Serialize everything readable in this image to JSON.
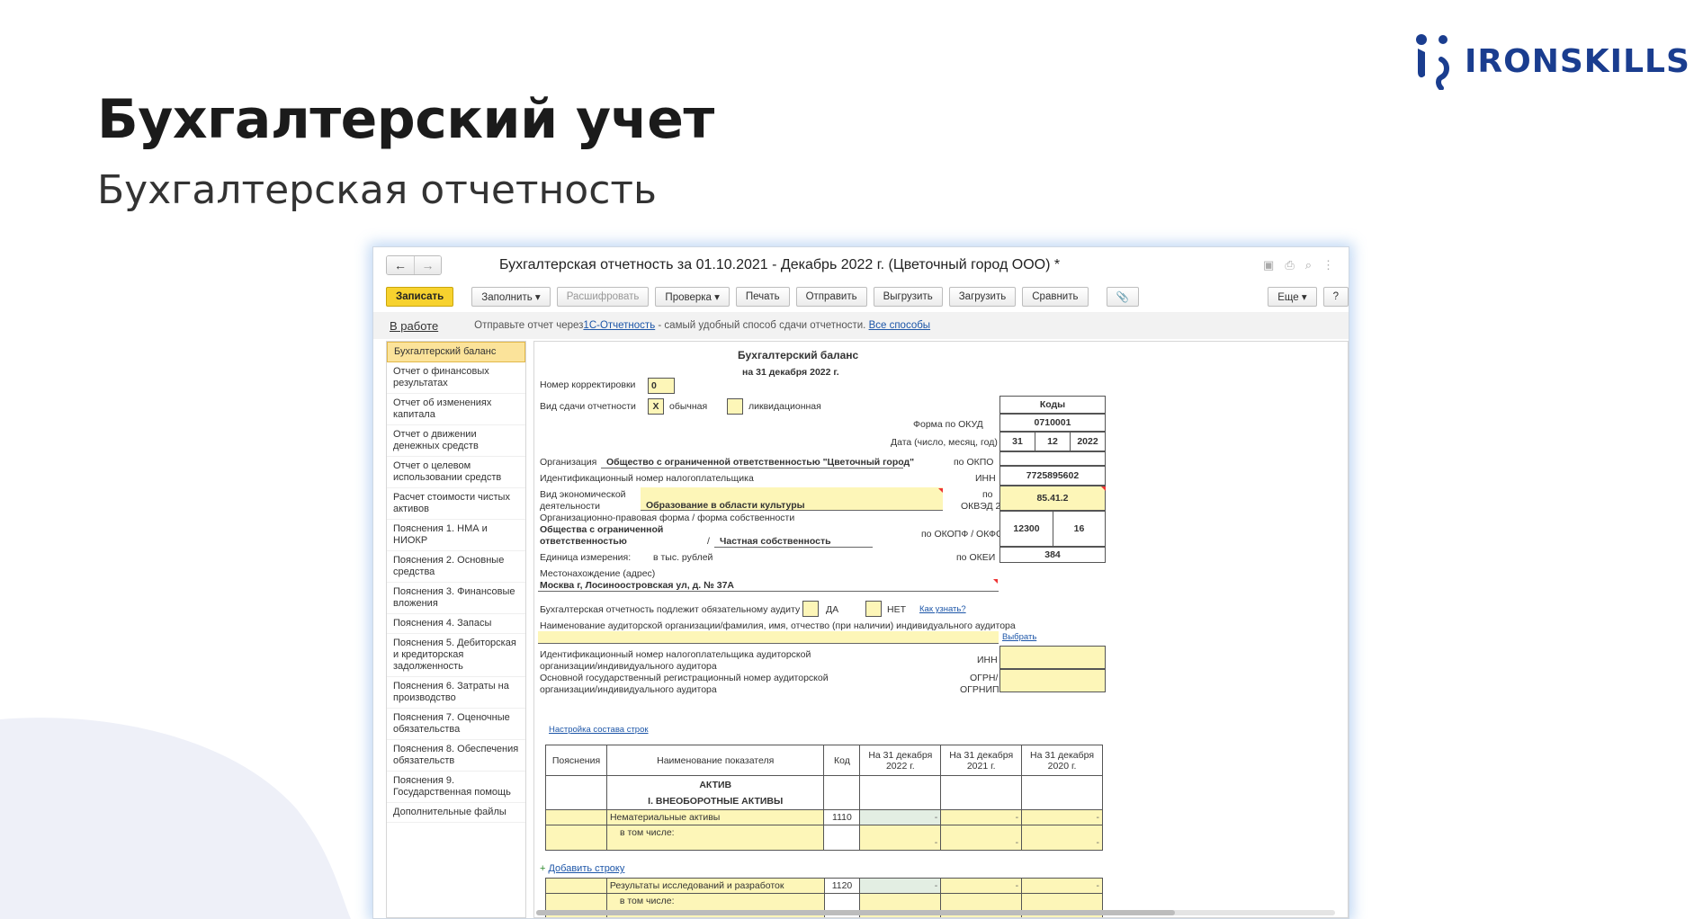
{
  "slide": {
    "title": "Бухгалтерский учет",
    "subtitle": "Бухгалтерская отчетность",
    "logo_text": "IRONSKILLS",
    "colors": {
      "logo": "#1a3d8f",
      "wave": "#eef0f8"
    }
  },
  "window": {
    "title": "Бухгалтерская отчетность за 01.10.2021 - Декабрь 2022 г. (Цветочный город ООО) *",
    "back_icon": "←",
    "forward_icon": "→",
    "more_icon": "⋮"
  },
  "toolbar": {
    "save": "Записать",
    "fill": "Заполнить ▾",
    "decode": "Расшифровать",
    "check": "Проверка ▾",
    "print": "Печать",
    "send": "Отправить",
    "export": "Выгрузить",
    "import": "Загрузить",
    "compare": "Сравнить",
    "attach_icon": "📎",
    "more": "Еще ▾",
    "help": "?"
  },
  "infobar": {
    "status": "В работе",
    "text_before": "Отправьте отчет через ",
    "link1": "1С-Отчетность",
    "text_after": " - самый удобный способ сдачи отчетности. ",
    "link2": "Все способы"
  },
  "sidebar": {
    "items": [
      "Бухгалтерский баланс",
      "Отчет о финансовых результатах",
      "Отчет об изменениях капитала",
      "Отчет о движении денежных средств",
      "Отчет о целевом использовании средств",
      "Расчет стоимости чистых активов",
      "Пояснения 1. НМА и НИОКР",
      "Пояснения 2. Основные средства",
      "Пояснения 3. Финансовые вложения",
      "Пояснения 4. Запасы",
      "Пояснения 5. Дебиторская и кредиторская задолженность",
      "Пояснения 6. Затраты на производство",
      "Пояснения 7. Оценочные обязательства",
      "Пояснения 8. Обеспечения обязательств",
      "Пояснения 9. Государственная помощь",
      "Дополнительные файлы"
    ]
  },
  "form": {
    "heading": "Бухгалтерский баланс",
    "date_heading": "на 31 декабря 2022 г.",
    "correction_label": "Номер корректировки",
    "correction_value": "0",
    "type_label": "Вид сдачи отчетности",
    "type_check": "X",
    "type_ordinary": "обычная",
    "type_liquidation": "ликвидационная",
    "codes_header": "Коды",
    "okud_label": "Форма по ОКУД",
    "okud_value": "0710001",
    "date_label": "Дата (число, месяц, год)",
    "date_day": "31",
    "date_month": "12",
    "date_year": "2022",
    "org_label": "Организация",
    "org_value": "Общество с ограниченной ответственностью \"Цветочный город\"",
    "okpo_label": "по ОКПО",
    "inn_caption": "Идентификационный номер налогоплательщика",
    "inn_label": "ИНН",
    "inn_value": "7725895602",
    "activity_label1": "Вид экономической",
    "activity_label2": "деятельности",
    "activity_value": "Образование в области культуры",
    "okved_label1": "по",
    "okved_label2": "ОКВЭД 2",
    "okved_value": "85.41.2",
    "legal_label": "Организационно-правовая форма / форма собственности",
    "legal_value1": "Общества с ограниченной",
    "legal_value2": "ответственностью",
    "legal_sep": "/",
    "ownership_value": "Частная собственность",
    "okopf_label": "по ОКОПФ / ОКФС",
    "okopf_value": "12300",
    "okfs_value": "16",
    "unit_label": "Единица измерения:",
    "unit_value": "в тыс. рублей",
    "okei_label": "по ОКЕИ",
    "okei_value": "384",
    "address_label": "Местонахождение (адрес)",
    "address_value": "Москва г, Лосиноостровская ул, д. № 37А",
    "audit_label": "Бухгалтерская отчетность подлежит обязательному аудиту",
    "audit_yes": "ДА",
    "audit_no": "НЕТ",
    "audit_link": "Как узнать?",
    "auditor_label": "Наименование аудиторской организации/фамилия, имя, отчество (при наличии) индивидуального аудитора",
    "auditor_choose": "Выбрать",
    "auditor_inn_label1": "Идентификационный номер налогоплательщика аудиторской",
    "auditor_inn_label2": "организации/индивидуального аудитора",
    "auditor_inn_short": "ИНН",
    "auditor_ogrn_label1": "Основной государственный регистрационный номер аудиторской",
    "auditor_ogrn_label2": "организации/индивидуального аудитора",
    "auditor_ogrn_short1": "ОГРН/",
    "auditor_ogrn_short2": "ОГРНИП",
    "rows_setup_link": "Настройка состава строк"
  },
  "table": {
    "headers": [
      "Пояснения",
      "Наименование показателя",
      "Код",
      "На 31 декабря 2022 г.",
      "На 31 декабря 2021 г.",
      "На 31 декабря 2020 г."
    ],
    "section": "АКТИВ",
    "subsection": "I. ВНЕОБОРОТНЫЕ АКТИВЫ",
    "row1_name": "Нематериальные активы",
    "row1_code": "1110",
    "including": "в том числе:",
    "dash": "-",
    "add_row": "Добавить строку",
    "row2_name": "Результаты исследований и разработок",
    "row2_code": "1120"
  }
}
